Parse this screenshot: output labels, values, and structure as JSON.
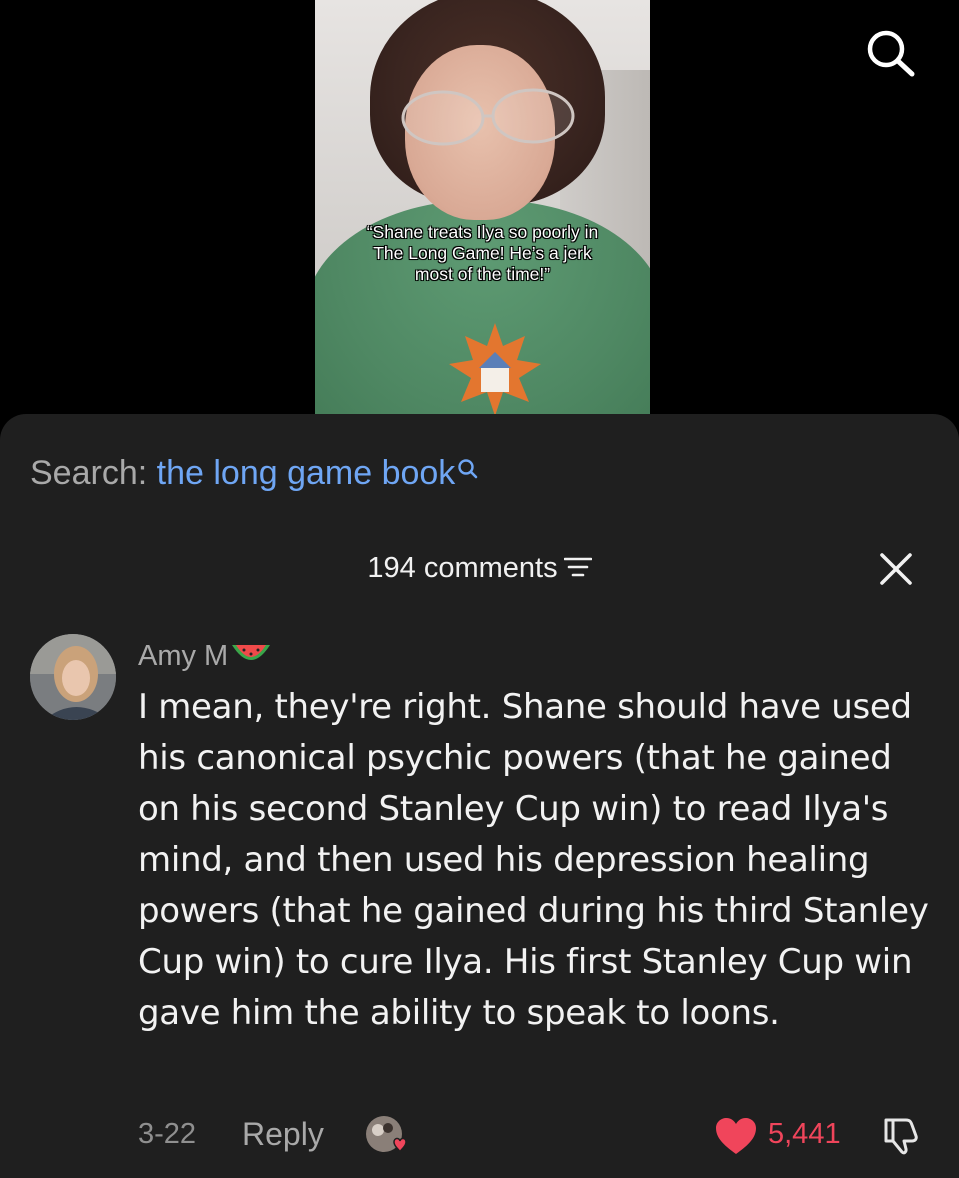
{
  "video": {
    "caption_lines": [
      "“Shane treats Ilya so poorly in",
      "The Long Game! He’s a jerk",
      "most of the time!”"
    ],
    "search_icon": "search-icon"
  },
  "search": {
    "label": "Search:",
    "query": "the long game book",
    "icon": "search-icon"
  },
  "comments_header": {
    "count_label": "194 comments",
    "sort_icon": "sort-lines-icon",
    "close_icon": "close-icon"
  },
  "comment": {
    "author": "Amy M",
    "author_emoji": "watermelon-icon",
    "text": "I mean, they're right. Shane should have used his canonical psychic powers (that he gained on his second Stanley Cup win) to read Ilya's mind, and then used his depression healing powers (that he gained during his third Stanley Cup win) to cure Ilya. His first Stanley Cup win gave him the ability to speak to loons.",
    "date": "3-22",
    "reply_label": "Reply",
    "likes": "5,441",
    "like_icon": "heart-icon",
    "dislike_icon": "thumbs-down-icon"
  },
  "colors": {
    "sheet_bg": "#1f1f1f",
    "link_blue": "#6fa6f4",
    "like_red": "#f0455b",
    "muted_text": "#a9a9a9"
  }
}
